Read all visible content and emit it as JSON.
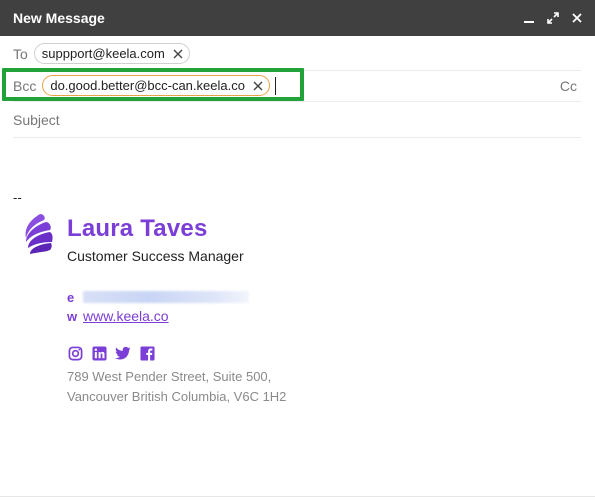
{
  "window": {
    "title": "New Message",
    "controls": [
      "minimize-icon",
      "expand-icon",
      "close-icon"
    ]
  },
  "to": {
    "label": "To",
    "recipients": [
      "suppport@keela.com"
    ]
  },
  "bcc": {
    "label": "Bcc",
    "recipients": [
      "do.good.better@bcc-can.keela.co"
    ],
    "cc_label": "Cc"
  },
  "subject": {
    "placeholder": "Subject",
    "value": ""
  },
  "signature": {
    "separator": "--",
    "name": "Laura Taves",
    "role": "Customer Success Manager",
    "email_label": "e",
    "web_label": "w",
    "website": " www.keela.co",
    "social": [
      "instagram-icon",
      "linkedin-icon",
      "twitter-icon",
      "facebook-icon"
    ],
    "address_line1": "789 West Pender Street, Suite 500,",
    "address_line2": "Vancouver British Columbia, V6C 1H2"
  },
  "colors": {
    "titlebar": "#404040",
    "brand_purple": "#7b3ed6",
    "highlight_green": "#22a339",
    "bcc_chip_border": "#e6a24a"
  }
}
